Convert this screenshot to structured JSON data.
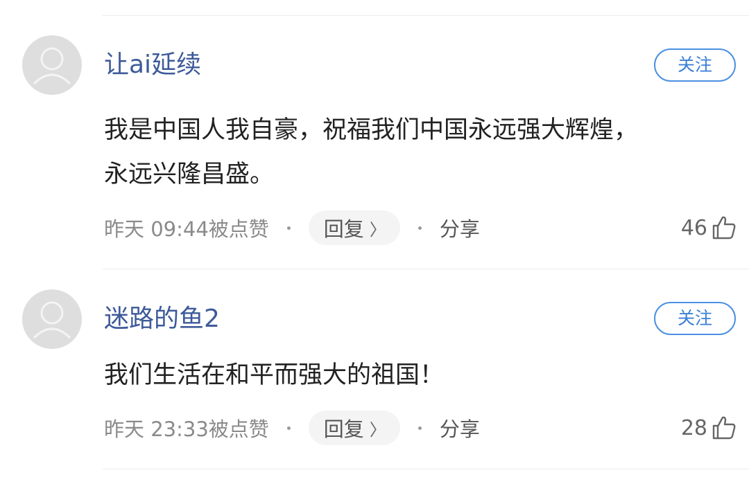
{
  "comments": [
    {
      "username": "让ai延续",
      "follow_label": "关注",
      "content_lines": [
        "我是中国人我自豪，祝福我们中国永远强大辉煌，",
        "永远兴隆昌盛。"
      ],
      "meta": "昨天 09:44被点赞",
      "reply_label": "回复",
      "reply_chevron": "〉",
      "share_label": "分享",
      "likes": "46",
      "avatar_icon": "default-user-avatar-icon",
      "like_icon": "thumbs-up-icon"
    },
    {
      "username": "迷路的鱼2",
      "follow_label": "关注",
      "content_lines": [
        "我们生活在和平而强大的祖国！"
      ],
      "meta": "昨天 23:33被点赞",
      "reply_label": "回复",
      "reply_chevron": "〉",
      "share_label": "分享",
      "likes": "28",
      "avatar_icon": "default-user-avatar-icon",
      "like_icon": "thumbs-up-icon"
    }
  ],
  "colors": {
    "username": "#3d5a99",
    "follow_border": "#4a90e2",
    "content": "#222222",
    "meta": "#8a8a8a",
    "avatar_bg": "#dedede"
  }
}
